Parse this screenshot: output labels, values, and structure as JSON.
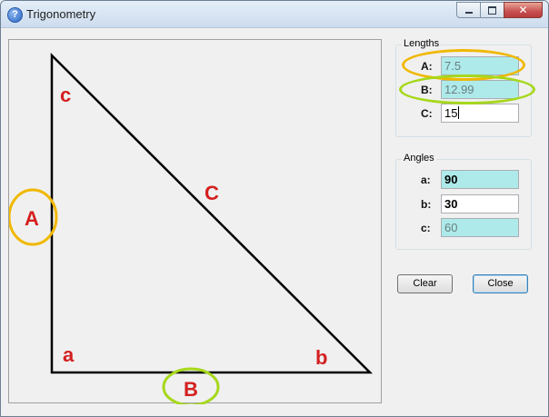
{
  "window": {
    "title": "Trigonometry",
    "app_icon": "help-icon",
    "controls": {
      "minimize": "minimize-icon",
      "maximize": "maximize-icon",
      "close": "close-icon"
    }
  },
  "diagram": {
    "side_labels": {
      "A": "A",
      "B": "B",
      "C": "C"
    },
    "angle_labels": {
      "a": "a",
      "b": "b",
      "c": "c"
    },
    "label_color": "#d42020",
    "highlight_colors": {
      "A": "#f0b800",
      "B": "#a6d81a"
    }
  },
  "lengths": {
    "title": "Lengths",
    "fields": [
      {
        "label": "A:",
        "value": "7.5",
        "readonly": true
      },
      {
        "label": "B:",
        "value": "12.99",
        "readonly": true
      },
      {
        "label": "C:",
        "value": "15",
        "readonly": false
      }
    ]
  },
  "angles": {
    "title": "Angles",
    "fields": [
      {
        "label": "a:",
        "value": "90",
        "readonly": true
      },
      {
        "label": "b:",
        "value": "30",
        "readonly": false
      },
      {
        "label": "c:",
        "value": "60",
        "readonly": true
      }
    ]
  },
  "buttons": {
    "clear": "Clear",
    "close": "Close"
  }
}
